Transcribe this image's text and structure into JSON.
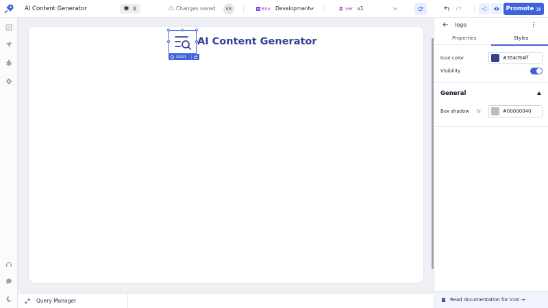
{
  "topbar": {
    "app_title": "AI Content Generator",
    "saved_status": "Changes saved",
    "avatar_initials": "KR",
    "env_label": "Env",
    "env_value": "Development",
    "version_label": "ver",
    "version_value": "v1",
    "promote_label": "Promote",
    "icons": [
      "rocket-logo-icon",
      "desktop-icon",
      "mobile-icon",
      "cloud-check-icon",
      "chevron-down-icon",
      "refresh-icon",
      "undo-icon",
      "redo-icon",
      "share-icon",
      "eye-icon",
      "double-chevron-right-icon"
    ]
  },
  "sidebar": {
    "items": [
      "pages-icon",
      "query-icon",
      "debugger-icon",
      "settings-icon",
      "support-icon",
      "chat-icon",
      "theme-icon"
    ]
  },
  "canvas": {
    "heading": "AI Content Generator",
    "selected_component_tag": "LOGO"
  },
  "bottombar": {
    "query_manager_label": "Query Manager"
  },
  "panel": {
    "component_name": "logo",
    "tabs": [
      {
        "label": "Properties",
        "active": false
      },
      {
        "label": "Styles",
        "active": true
      }
    ],
    "icon_color_label": "Icon color",
    "icon_color_value": "#354094ff",
    "icon_color_swatch": "#354094",
    "visibility_label": "Visibility",
    "visibility_on": true,
    "section_general": "General",
    "box_shadow_label": "Box shadow",
    "fx_label": "fx",
    "box_shadow_value": "#00000040",
    "box_shadow_swatch": "#bdbdbd",
    "docs_link": "Read documentation for Icon →"
  },
  "colors": {
    "accent": "#3e63dd",
    "heading": "#354094",
    "env_tag": "#7c3aed"
  }
}
